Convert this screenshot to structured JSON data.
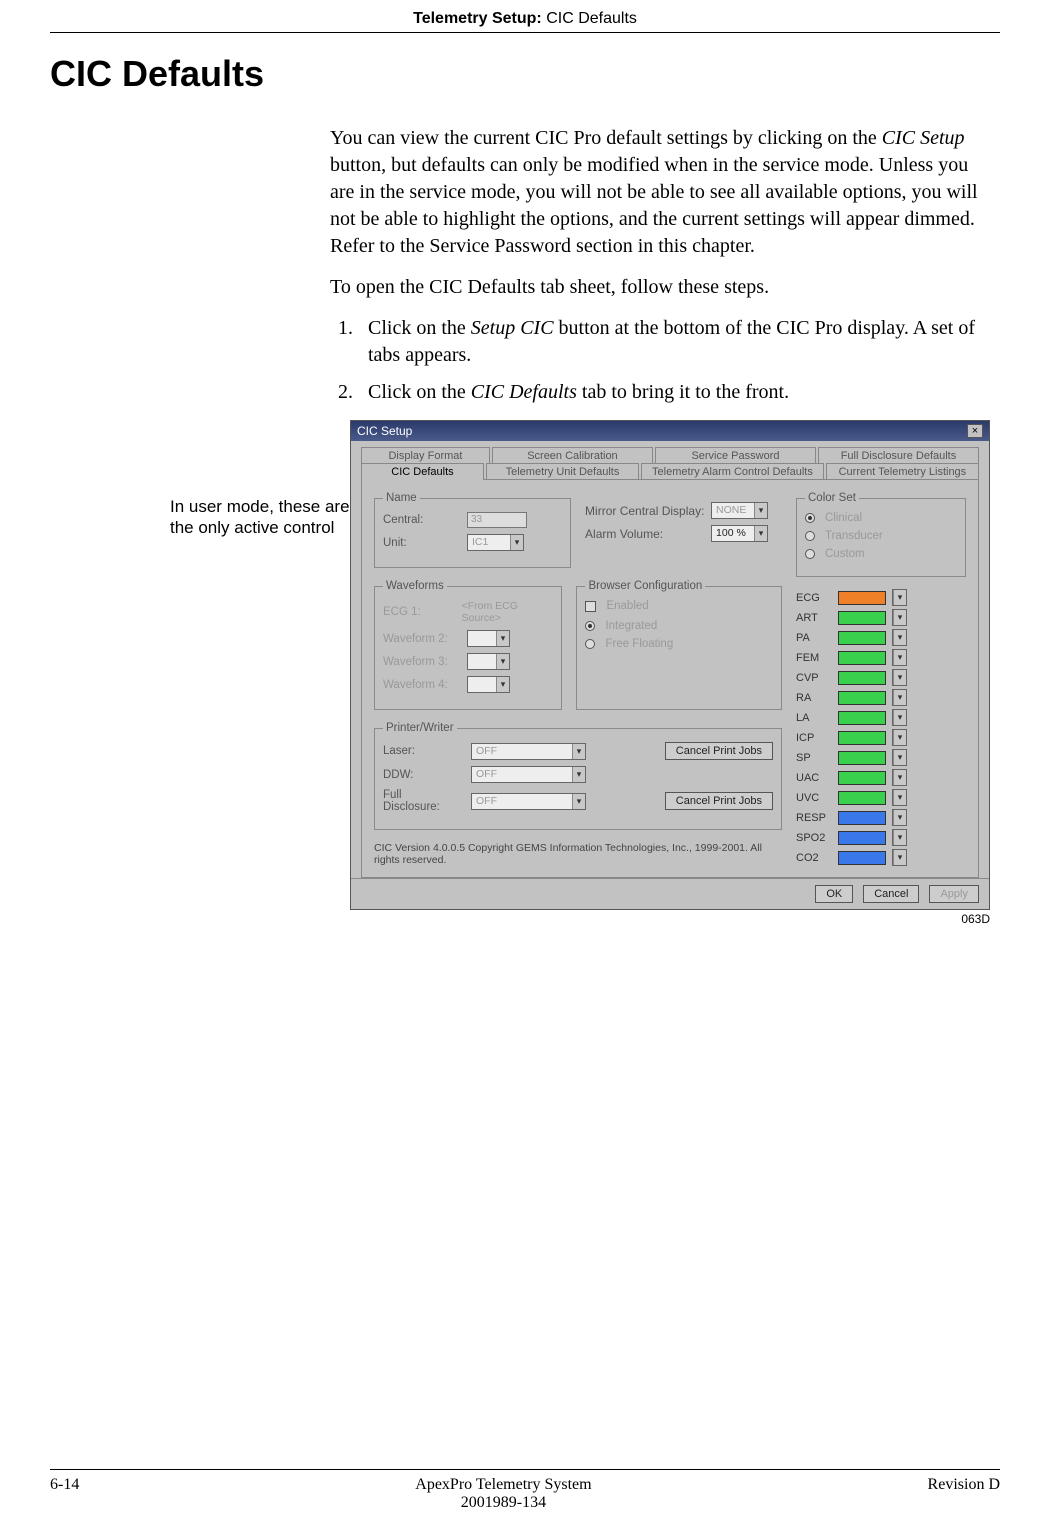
{
  "header": {
    "bold": "Telemetry Setup: ",
    "plain": "CIC Defaults"
  },
  "title": "CIC Defaults",
  "para1a": "You can view the current CIC Pro default settings by clicking on the ",
  "para1b": "CIC Setup",
  "para1c": " button, but defaults can only be modified when in the service mode. Unless you are in the service mode, you will not be able to see all available options, you will not be able to highlight the options, and the current settings will appear dimmed. Refer to the Service Password section in this chapter.",
  "para2": "To open the CIC Defaults tab sheet, follow these steps.",
  "step1a": "Click on the ",
  "step1b": "Setup CIC",
  "step1c": " button at the bottom of the CIC Pro display. A set of tabs appears.",
  "step2a": "Click on the ",
  "step2b": "CIC Defaults",
  "step2c": " tab to bring it to the front.",
  "callout": "In user mode, these are the only active control",
  "fig_id": "063D",
  "dialog": {
    "title": "CIC Setup",
    "close": "×",
    "tabs_top": [
      "Display Format",
      "Screen Calibration",
      "Service Password",
      "Full Disclosure Defaults"
    ],
    "tabs_bottom": [
      "CIC Defaults",
      "Telemetry Unit Defaults",
      "Telemetry Alarm Control Defaults",
      "Current Telemetry Listings"
    ],
    "name": {
      "legend": "Name",
      "central_lbl": "Central:",
      "central_val": "33",
      "unit_lbl": "Unit:",
      "unit_val": "IC1"
    },
    "mirror_lbl": "Mirror Central Display:",
    "mirror_val": "NONE",
    "alarm_lbl": "Alarm Volume:",
    "alarm_val": "100 %",
    "waveforms": {
      "legend": "Waveforms",
      "ecg_lbl": "ECG 1:",
      "ecg_src": "<From ECG Source>",
      "w2": "Waveform 2:",
      "w3": "Waveform 3:",
      "w4": "Waveform 4:"
    },
    "browser": {
      "legend": "Browser Configuration",
      "enabled": "Enabled",
      "integrated": "Integrated",
      "free": "Free Floating"
    },
    "printer": {
      "legend": "Printer/Writer",
      "laser": "Laser:",
      "ddw": "DDW:",
      "full": "Full Disclosure:",
      "off": "OFF",
      "cancel_jobs": "Cancel Print Jobs"
    },
    "color": {
      "legend": "Color Set",
      "opts": [
        "Clinical",
        "Transducer",
        "Custom"
      ],
      "params": [
        {
          "name": "ECG",
          "color": "#f08028"
        },
        {
          "name": "ART",
          "color": "#38d04c"
        },
        {
          "name": "PA",
          "color": "#38d04c"
        },
        {
          "name": "FEM",
          "color": "#38d04c"
        },
        {
          "name": "CVP",
          "color": "#38d04c"
        },
        {
          "name": "RA",
          "color": "#38d04c"
        },
        {
          "name": "LA",
          "color": "#38d04c"
        },
        {
          "name": "ICP",
          "color": "#38d04c"
        },
        {
          "name": "SP",
          "color": "#38d04c"
        },
        {
          "name": "UAC",
          "color": "#38d04c"
        },
        {
          "name": "UVC",
          "color": "#38d04c"
        },
        {
          "name": "RESP",
          "color": "#3878e8"
        },
        {
          "name": "SPO2",
          "color": "#3878e8"
        },
        {
          "name": "CO2",
          "color": "#3878e8"
        }
      ]
    },
    "version": "CIC Version 4.0.0.5  Copyright GEMS Information Technologies, Inc., 1999-2001. All rights reserved.",
    "ok": "OK",
    "cancel": "Cancel",
    "apply": "Apply"
  },
  "footer": {
    "left": "6-14",
    "center1": "ApexPro Telemetry System",
    "center2": "2001989-134",
    "right": "Revision D"
  }
}
